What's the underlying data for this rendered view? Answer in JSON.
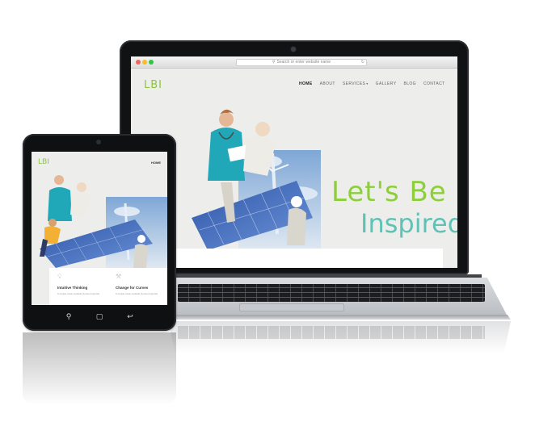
{
  "browser": {
    "address_placeholder": "Search or enter website name"
  },
  "site": {
    "logo": "LBI",
    "nav": [
      {
        "label": "HOME"
      },
      {
        "label": "ABOUT"
      },
      {
        "label": "SERVICES"
      },
      {
        "label": "GALLERY"
      },
      {
        "label": "BLOG"
      },
      {
        "label": "CONTACT"
      }
    ],
    "hero": {
      "line1": "Let's Be",
      "line2": "Inspired"
    }
  },
  "tablet": {
    "logo": "LBI",
    "nav_label": "HOME",
    "features": [
      {
        "icon": "lightbulb-icon",
        "title": "Intuitive Thinking",
        "text": "A simple clean website Sunset Inspired"
      },
      {
        "icon": "wrench-icon",
        "title": "Change for Curves",
        "text": "A simple clean website Sunset Inspired"
      }
    ],
    "buttons": [
      {
        "icon": "search-icon"
      },
      {
        "icon": "home-icon"
      },
      {
        "icon": "back-icon"
      }
    ]
  },
  "colors": {
    "brand_green": "#8ccf3a",
    "brand_teal": "#5fc2b5",
    "device_black": "#111214",
    "screen_bg": "#ededeb"
  }
}
